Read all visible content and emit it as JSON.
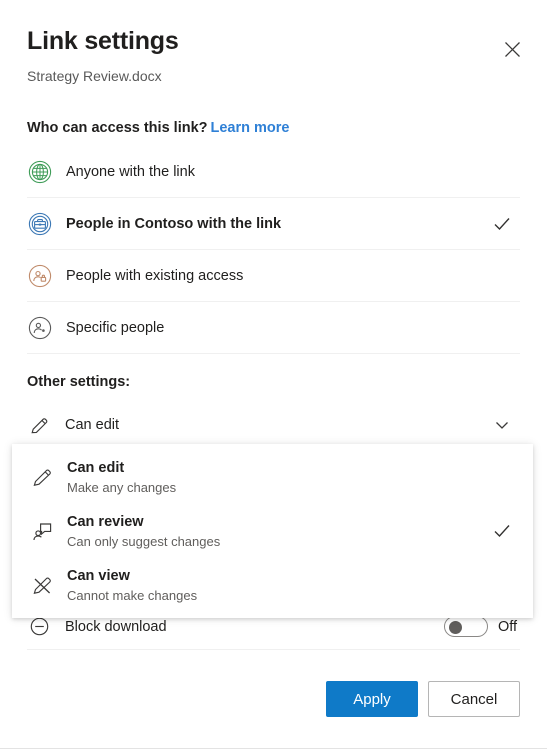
{
  "dialog": {
    "title": "Link settings",
    "file_name": "Strategy Review.docx",
    "close_icon": "close-icon"
  },
  "access": {
    "question": "Who can access this link?",
    "learn_more": "Learn more",
    "options": [
      {
        "label": "Anyone with the link",
        "icon": "globe-icon",
        "selected": false,
        "color": "#3f9c58"
      },
      {
        "label": "People in Contoso with the link",
        "icon": "briefcase-icon",
        "selected": true,
        "color": "#3b78b5"
      },
      {
        "label": "People with existing access",
        "icon": "person-lock-icon",
        "selected": false,
        "color": "#c08b6b"
      },
      {
        "label": "Specific people",
        "icon": "person-add-icon",
        "selected": false,
        "color": "#5a5a5a"
      }
    ],
    "check_mark": "✓"
  },
  "other_settings": {
    "heading": "Other settings:",
    "permission": {
      "label": "Can edit",
      "icon": "pencil-icon",
      "chevron": "chevron-down-icon"
    },
    "block_download": {
      "label": "Block download",
      "icon": "block-icon",
      "state": "Off",
      "enabled": false
    }
  },
  "permission_menu": {
    "open": true,
    "items": [
      {
        "title": "Can edit",
        "description": "Make any changes",
        "icon": "pencil-icon",
        "selected": false
      },
      {
        "title": "Can review",
        "description": "Can only suggest changes",
        "icon": "review-comment-icon",
        "selected": true
      },
      {
        "title": "Can view",
        "description": "Cannot make changes",
        "icon": "pencil-slash-icon",
        "selected": false
      }
    ]
  },
  "footer": {
    "apply_label": "Apply",
    "cancel_label": "Cancel",
    "accent_color": "#0f7ac8"
  }
}
